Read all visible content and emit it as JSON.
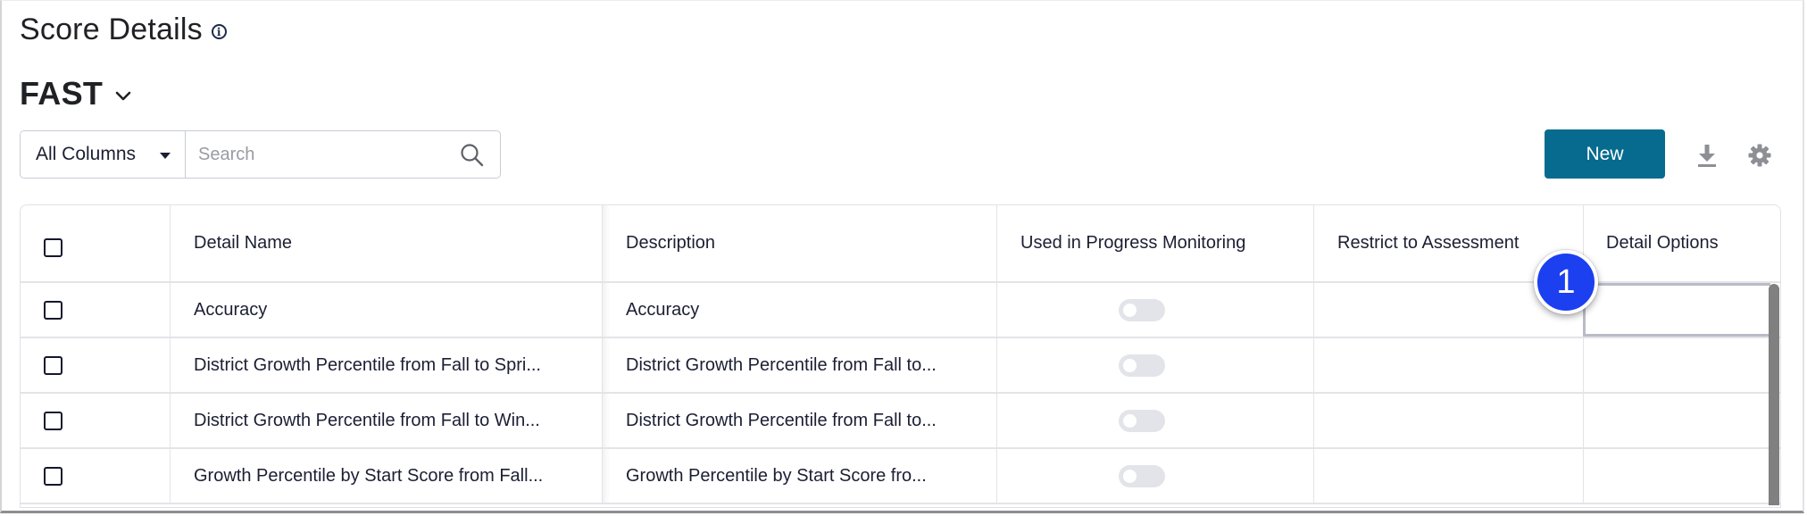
{
  "page": {
    "title": "Score Details",
    "info_icon": "info-circle-icon",
    "assessment": "FAST",
    "assessment_icon": "chevron-down-icon"
  },
  "filter": {
    "column_select": "All Columns",
    "search_placeholder": "Search",
    "search_value": ""
  },
  "toolbar": {
    "new_label": "New",
    "download_icon": "download-icon",
    "settings_icon": "gear-icon"
  },
  "colors": {
    "primary": "#066b8f",
    "badge": "#1c3ff0",
    "toggle_off": "#e3e4e9"
  },
  "table": {
    "columns": [
      "",
      "Detail Name",
      "Description",
      "Used in Progress Monitoring",
      "Restrict to Assessment",
      "Detail Options"
    ],
    "rows": [
      {
        "name": "Accuracy",
        "description": "Accuracy",
        "progress_monitoring": false,
        "restrict": "",
        "options": ""
      },
      {
        "name": "District Growth Percentile from Fall to Spri...",
        "description": "District Growth Percentile from Fall to...",
        "progress_monitoring": false,
        "restrict": "",
        "options": ""
      },
      {
        "name": "District Growth Percentile from Fall to Win...",
        "description": "District Growth Percentile from Fall to...",
        "progress_monitoring": false,
        "restrict": "",
        "options": ""
      },
      {
        "name": "Growth Percentile by Start Score from Fall...",
        "description": "Growth Percentile by Start Score fro...",
        "progress_monitoring": false,
        "restrict": "",
        "options": ""
      }
    ]
  },
  "annotation": {
    "step_number": "1"
  }
}
